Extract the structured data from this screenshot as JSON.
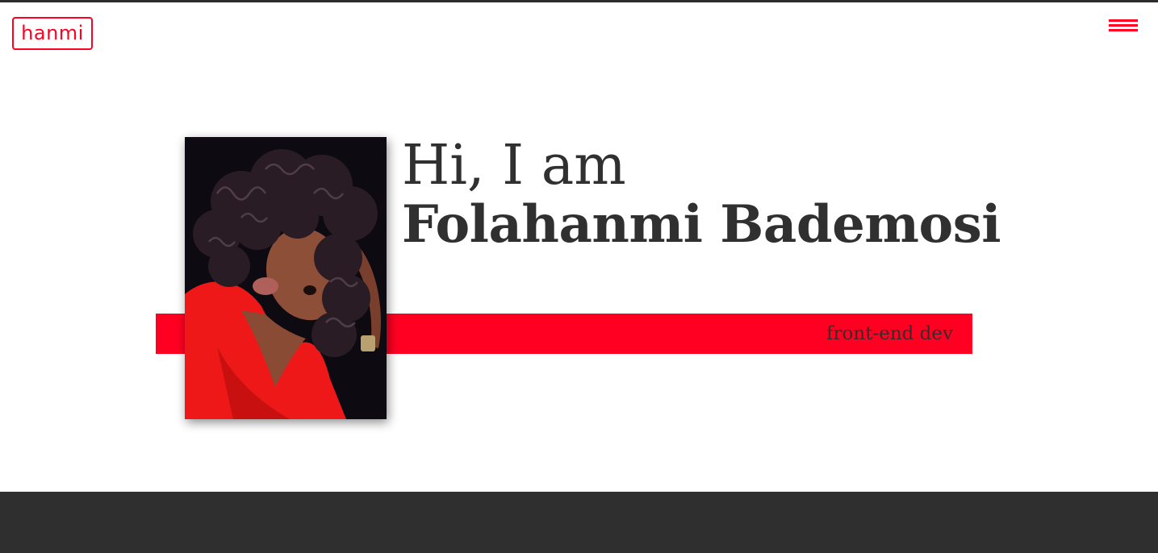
{
  "header": {
    "logo_text": "hanmi",
    "menu_icon": "hamburger-icon"
  },
  "hero": {
    "greeting": "Hi, I am",
    "name": "Folahanmi Bademosi",
    "role": "front-end dev",
    "photo": "portrait-photo"
  },
  "colors": {
    "accent": "#ff0022",
    "text": "#303030",
    "footer": "#2f2f2f",
    "topbar": "#2b2b2b"
  }
}
